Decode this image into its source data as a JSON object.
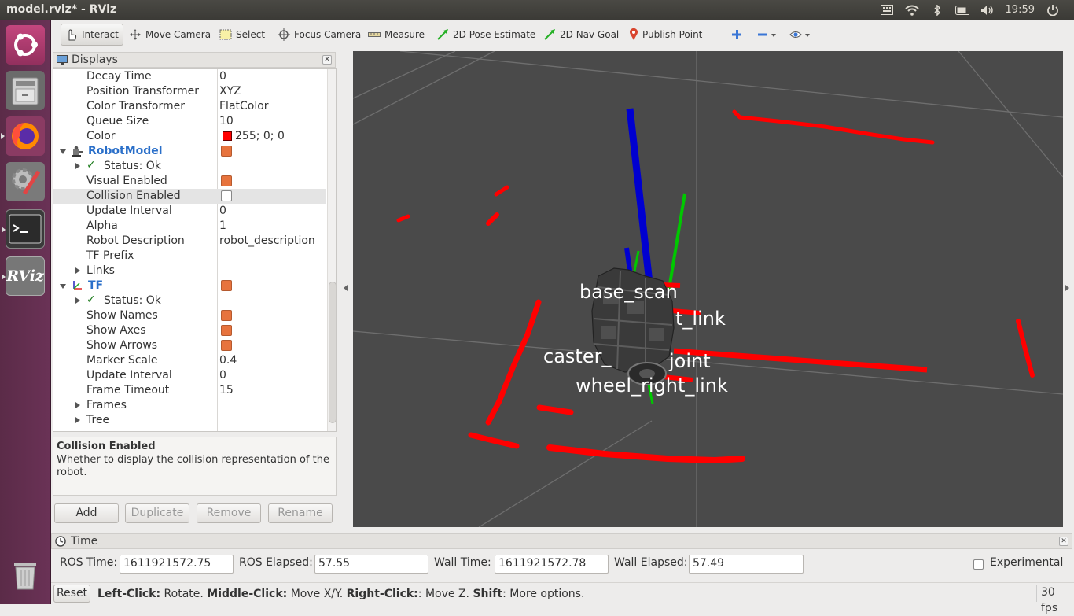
{
  "window": {
    "title": "model.rviz* - RViz"
  },
  "system_tray": {
    "clock": "19:59",
    "icons": [
      "keyboard-icon",
      "wifi-icon",
      "bluetooth-icon",
      "battery-icon",
      "volume-icon",
      "power-icon"
    ]
  },
  "launcher": {
    "items": [
      "ubuntu-dash",
      "files",
      "firefox",
      "system-settings",
      "terminal",
      "rviz",
      "trash"
    ],
    "rviz_label": "RViz"
  },
  "toolbar": {
    "interact": "Interact",
    "move_camera": "Move Camera",
    "select": "Select",
    "focus_camera": "Focus Camera",
    "measure": "Measure",
    "pose_estimate": "2D Pose Estimate",
    "nav_goal": "2D Nav Goal",
    "publish_point": "Publish Point"
  },
  "displays": {
    "title": "Displays",
    "rows": {
      "decay_time": {
        "k": "Decay Time",
        "v": "0"
      },
      "position_transformer": {
        "k": "Position Transformer",
        "v": "XYZ"
      },
      "color_transformer": {
        "k": "Color Transformer",
        "v": "FlatColor"
      },
      "queue_size": {
        "k": "Queue Size",
        "v": "10"
      },
      "color": {
        "k": "Color",
        "v": "255; 0; 0",
        "swatch": "#ff0000"
      },
      "robot_model": {
        "k": "RobotModel"
      },
      "rm_status": {
        "k": "Status: Ok"
      },
      "visual_enabled": {
        "k": "Visual Enabled"
      },
      "collision_enabled": {
        "k": "Collision Enabled"
      },
      "rm_update_interval": {
        "k": "Update Interval",
        "v": "0"
      },
      "alpha": {
        "k": "Alpha",
        "v": "1"
      },
      "robot_description": {
        "k": "Robot Description",
        "v": "robot_description"
      },
      "tf_prefix": {
        "k": "TF Prefix",
        "v": ""
      },
      "links": {
        "k": "Links"
      },
      "tf": {
        "k": "TF"
      },
      "tf_status": {
        "k": "Status: Ok"
      },
      "show_names": {
        "k": "Show Names"
      },
      "show_axes": {
        "k": "Show Axes"
      },
      "show_arrows": {
        "k": "Show Arrows"
      },
      "marker_scale": {
        "k": "Marker Scale",
        "v": "0.4"
      },
      "tf_update_interval": {
        "k": "Update Interval",
        "v": "0"
      },
      "frame_timeout": {
        "k": "Frame Timeout",
        "v": "15"
      },
      "frames": {
        "k": "Frames"
      },
      "tree": {
        "k": "Tree"
      }
    },
    "help": {
      "heading": "Collision Enabled",
      "text": "Whether to display the collision representation of the robot."
    },
    "buttons": {
      "add": "Add",
      "duplicate": "Duplicate",
      "remove": "Remove",
      "rename": "Rename"
    }
  },
  "viewport": {
    "labels": {
      "base_scan": "base_scan",
      "left_link": "t_link",
      "caster": "caster_",
      "joint": "joint",
      "wheel_right": "wheel_right_link"
    },
    "colors": {
      "background": "#4a4a4a",
      "grid": "#6e6e6e",
      "laser": "#ff0000",
      "axis_x": "#ff0000",
      "axis_y": "#00c800",
      "axis_z": "#0000d0"
    }
  },
  "time": {
    "title": "Time",
    "ros_time_label": "ROS Time:",
    "ros_time": "1611921572.75",
    "ros_elapsed_label": "ROS Elapsed:",
    "ros_elapsed": "57.55",
    "wall_time_label": "Wall Time:",
    "wall_time": "1611921572.78",
    "wall_elapsed_label": "Wall Elapsed:",
    "wall_elapsed": "57.49",
    "experimental": "Experimental"
  },
  "status": {
    "reset": "Reset",
    "left_click_key": "Left-Click:",
    "left_click": " Rotate. ",
    "middle_click_key": "Middle-Click:",
    "middle_click": " Move X/Y. ",
    "right_click_key": "Right-Click:",
    "right_click": ": Move Z. ",
    "shift_key": "Shift",
    "shift": ": More options.",
    "fps": "30 fps"
  }
}
